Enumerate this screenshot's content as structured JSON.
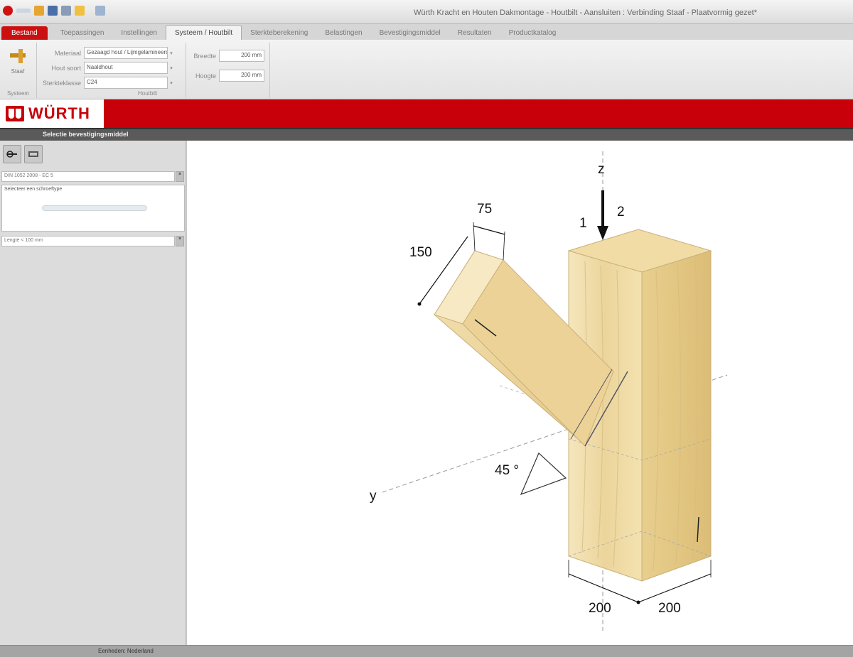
{
  "window": {
    "title": "Würth Kracht en Houten Dakmontage - Houtbilt - Aansluiten : Verbinding Staaf - Plaatvormig gezet*"
  },
  "tabs": [
    {
      "label": "Bestand"
    },
    {
      "label": "Toepassingen"
    },
    {
      "label": "Instellingen"
    },
    {
      "label": "Systeem / Houtbilt"
    },
    {
      "label": "Sterkteberekening"
    },
    {
      "label": "Belastingen"
    },
    {
      "label": "Bevestigingsmiddel"
    },
    {
      "label": "Resultaten"
    },
    {
      "label": "Productkatalog"
    }
  ],
  "ribbon": {
    "system_button": "Staaf",
    "system_group": "Systeem",
    "fields": [
      {
        "label": "Materiaal",
        "value": "Gezaagd hout / Lijmgelamineerd hout"
      },
      {
        "label": "Hout soort",
        "value": "Naaldhout"
      },
      {
        "label": "Sterkteklasse",
        "value": "C24"
      }
    ],
    "group_label": "Houtbilt",
    "right_fields": [
      {
        "label": "Breedte",
        "value": "200 mm"
      },
      {
        "label": "Hoogte",
        "value": "200 mm"
      }
    ]
  },
  "brand": {
    "name": "WÜRTH"
  },
  "subbar": {
    "text": "Selectie bevestigingsmiddel"
  },
  "left_panel": {
    "filter_value": "DIN 1052 2008 - EC 5",
    "list_text": "Selecteer een schroeftype",
    "bottom_input": "Lengte < 100 mm"
  },
  "drawing": {
    "axis_z": "z",
    "axis_y": "y",
    "force_1": "1",
    "force_2": "2",
    "dim_75": "75",
    "dim_150": "150",
    "angle": "45 °",
    "dim_200_left": "200",
    "dim_200_right": "200",
    "wood_light": "#f3e2b0",
    "wood_mid": "#e8cf8e",
    "wood_dark": "#d9b96e"
  },
  "status": {
    "text": "Eenheden: Nederland"
  }
}
